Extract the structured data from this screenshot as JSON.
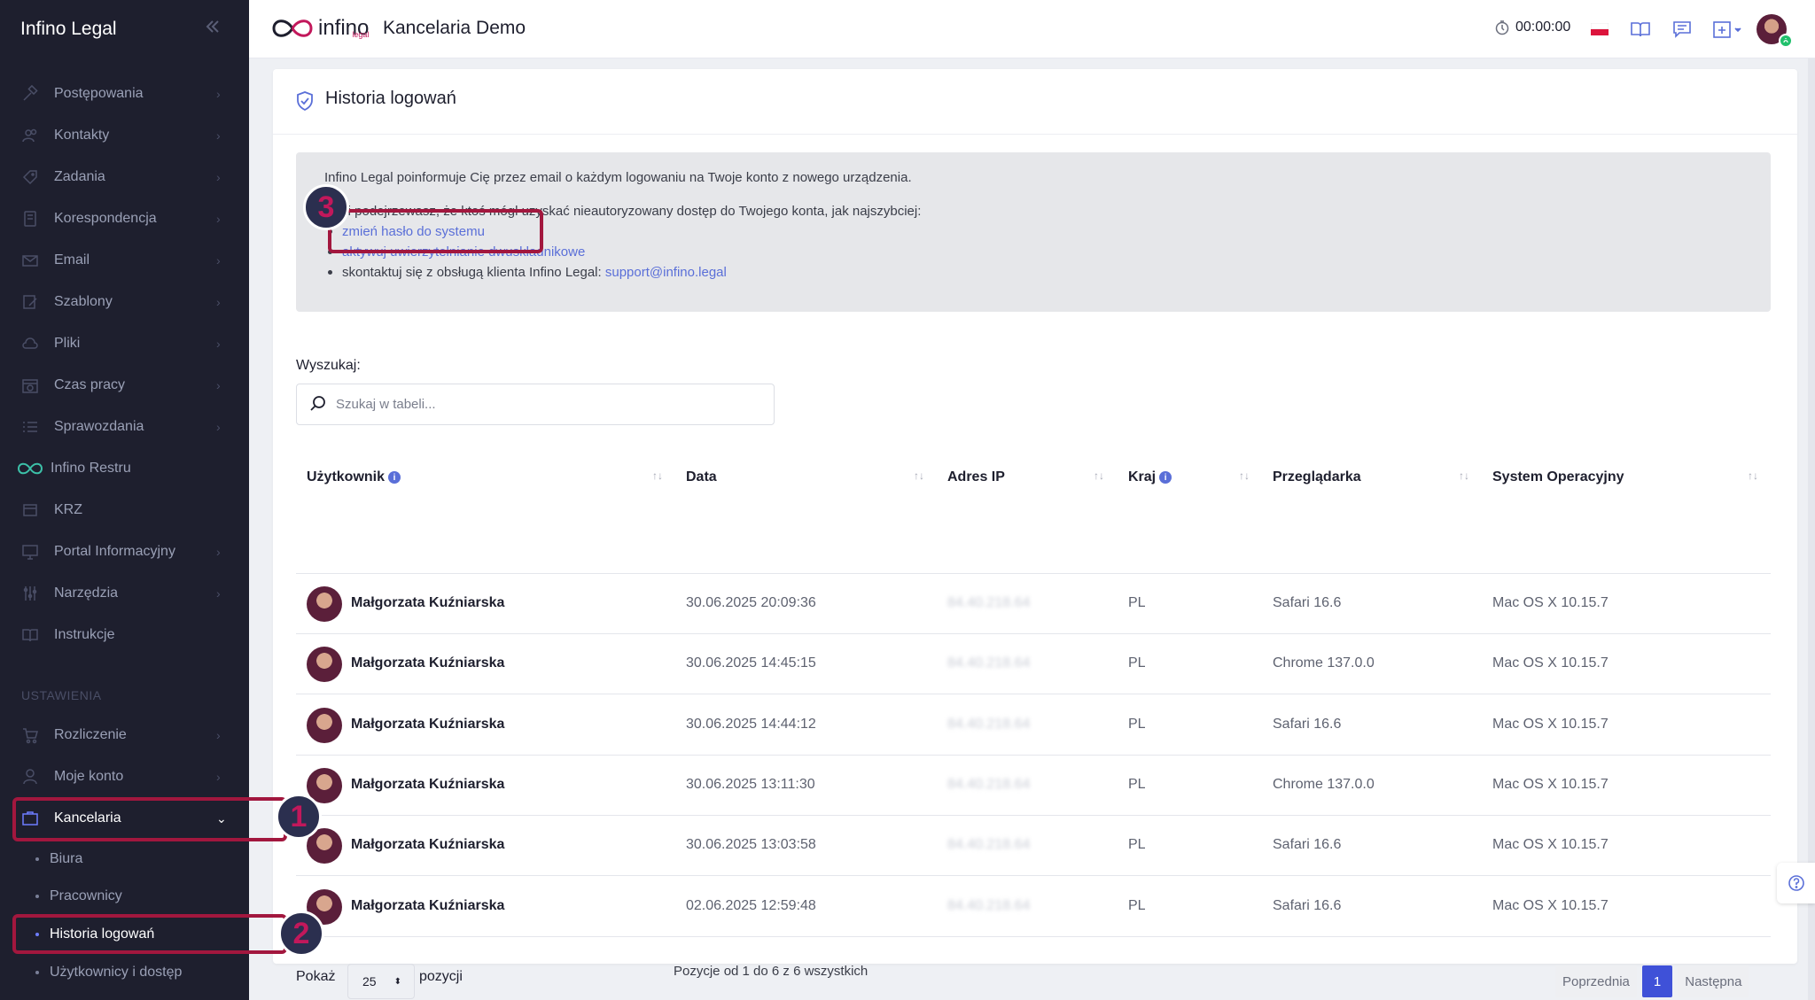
{
  "app": {
    "brand": "Infino Legal",
    "logo_text": "infino",
    "logo_sub": "legal",
    "title": "Kancelaria Demo",
    "timer": "00:00:00"
  },
  "sidebar": {
    "items": [
      {
        "label": "Postępowania",
        "icon": "gavel-icon",
        "chevron": "›"
      },
      {
        "label": "Kontakty",
        "icon": "contacts-icon",
        "chevron": "›"
      },
      {
        "label": "Zadania",
        "icon": "tasks-icon",
        "chevron": "›"
      },
      {
        "label": "Korespondencja",
        "icon": "mail-book-icon",
        "chevron": "›"
      },
      {
        "label": "Email",
        "icon": "envelope-icon",
        "chevron": "›"
      },
      {
        "label": "Szablony",
        "icon": "template-icon",
        "chevron": "›"
      },
      {
        "label": "Pliki",
        "icon": "cloud-icon",
        "chevron": "›"
      },
      {
        "label": "Czas pracy",
        "icon": "calendar-clock-icon",
        "chevron": "›"
      },
      {
        "label": "Sprawozdania",
        "icon": "list-icon",
        "chevron": "›"
      },
      {
        "label": "Infino Restru",
        "icon": "infinity-icon",
        "chevron": ""
      },
      {
        "label": "KRZ",
        "icon": "registry-icon",
        "chevron": ""
      },
      {
        "label": "Portal Informacyjny",
        "icon": "monitor-icon",
        "chevron": "›"
      },
      {
        "label": "Narzędzia",
        "icon": "sliders-icon",
        "chevron": "›"
      },
      {
        "label": "Instrukcje",
        "icon": "book-icon",
        "chevron": ""
      }
    ],
    "section_label": "USTAWIENIA",
    "settings_items": [
      {
        "label": "Rozliczenie",
        "icon": "cart-icon",
        "chevron": "›"
      },
      {
        "label": "Moje konto",
        "icon": "user-icon",
        "chevron": "›"
      },
      {
        "label": "Kancelaria",
        "icon": "briefcase-icon",
        "chevron": "⌄"
      }
    ],
    "sub_items": [
      "Biura",
      "Pracownicy",
      "Historia logowań",
      "Użytkownicy i dostęp"
    ]
  },
  "page": {
    "title": "Historia logowań",
    "info": {
      "line1": "Infino Legal poinformuje Cię przez email o każdym logowaniu na Twoje konto z nowego urządzenia.",
      "line2": "Jeśli podejrzewasz, że ktoś mógł uzyskać nieautoryzowany dostęp do Twojego konta, jak najszybciej:",
      "bullet1": "zmień hasło do systemu",
      "bullet2": "aktywuj uwierzytelnianie dwuskładnikowe",
      "bullet3_prefix": "skontaktuj się z obsługą klienta Infino Legal: ",
      "bullet3_link": "support@infino.legal"
    },
    "search": {
      "label": "Wyszukaj:",
      "placeholder": "Szukaj w tabeli..."
    },
    "table": {
      "columns": [
        "Użytkownik",
        "Data",
        "Adres IP",
        "Kraj",
        "Przeglądarka",
        "System Operacyjny"
      ],
      "rows": [
        {
          "user": "Małgorzata Kuźniarska",
          "date": "30.06.2025 20:09:36",
          "ip": "84.40.218.64",
          "country": "PL",
          "browser": "Safari 16.6",
          "os": "Mac OS X 10.15.7"
        },
        {
          "user": "Małgorzata Kuźniarska",
          "date": "30.06.2025 14:45:15",
          "ip": "84.40.218.64",
          "country": "PL",
          "browser": "Chrome 137.0.0",
          "os": "Mac OS X 10.15.7"
        },
        {
          "user": "Małgorzata Kuźniarska",
          "date": "30.06.2025 14:44:12",
          "ip": "84.40.218.64",
          "country": "PL",
          "browser": "Safari 16.6",
          "os": "Mac OS X 10.15.7"
        },
        {
          "user": "Małgorzata Kuźniarska",
          "date": "30.06.2025 13:11:30",
          "ip": "84.40.218.64",
          "country": "PL",
          "browser": "Chrome 137.0.0",
          "os": "Mac OS X 10.15.7"
        },
        {
          "user": "Małgorzata Kuźniarska",
          "date": "30.06.2025 13:03:58",
          "ip": "84.40.218.64",
          "country": "PL",
          "browser": "Safari 16.6",
          "os": "Mac OS X 10.15.7"
        },
        {
          "user": "Małgorzata Kuźniarska",
          "date": "02.06.2025 12:59:48",
          "ip": "84.40.218.64",
          "country": "PL",
          "browser": "Safari 16.6",
          "os": "Mac OS X 10.15.7"
        }
      ]
    },
    "footer": {
      "show_label": "Pokaż",
      "per_page": "25",
      "items_label": "pozycji",
      "summary": "Pozycje od 1 do 6 z 6 wszystkich",
      "prev": "Poprzednia",
      "current_page": "1",
      "next": "Następna"
    }
  },
  "annotations": {
    "badge1": "1",
    "badge2": "2",
    "badge3": "3"
  },
  "colors": {
    "sidebar_bg": "#1e1f2e",
    "accent": "#5a6fd8",
    "annotation": "#a2173e",
    "page_active": "#3f51d8"
  }
}
